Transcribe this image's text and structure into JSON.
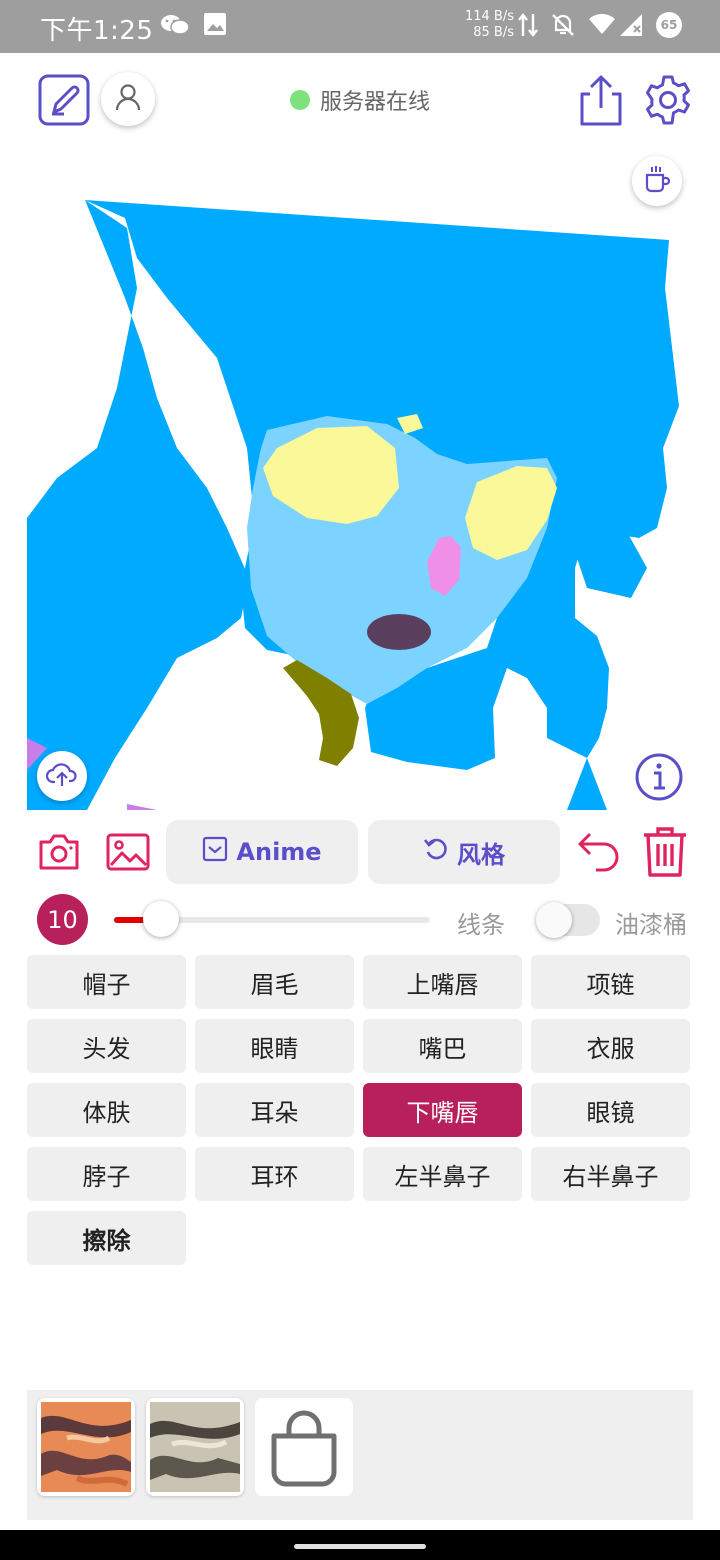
{
  "status_bar": {
    "time": "下午1:25",
    "speed_up": "114 B/s",
    "speed_down": "85 B/s",
    "battery": "65",
    "icons": [
      "wechat-icon",
      "image-icon",
      "data-arrows-icon",
      "mute-bell-icon",
      "wifi-icon",
      "signal-icon"
    ]
  },
  "header": {
    "server_status": "服务器在线",
    "server_status_color": "#7ee27c",
    "icons": [
      "edit-icon",
      "user-icon",
      "share-icon",
      "settings-icon"
    ]
  },
  "canvas": {
    "icons": [
      "coffee-icon",
      "cloud-upload-icon",
      "info-icon"
    ],
    "segment_colors": {
      "hair": "#00aaff",
      "skin": "#7dd3ff",
      "eyes": "#fbf89a",
      "ear": "#f08fe8",
      "mouth": "#5a3f5e",
      "neck": "#7f7f00"
    }
  },
  "tools": {
    "anime_label": "Anime",
    "style_label": "风格",
    "icons": [
      "camera-icon",
      "gallery-icon",
      "checkbox-icon",
      "refresh-icon",
      "undo-icon",
      "trash-icon"
    ]
  },
  "brush": {
    "size": "10",
    "slider_fraction": 0.15,
    "line_label": "线条",
    "bucket_label": "油漆桶",
    "bucket_enabled": false
  },
  "labels": [
    [
      "帽子",
      "眉毛",
      "上嘴唇",
      "项链"
    ],
    [
      "头发",
      "眼睛",
      "嘴巴",
      "衣服"
    ],
    [
      "体肤",
      "耳朵",
      "下嘴唇",
      "眼镜"
    ],
    [
      "脖子",
      "耳环",
      "左半鼻子",
      "右半鼻子"
    ],
    [
      "擦除"
    ]
  ],
  "selected_label": "下嘴唇",
  "accent_color": "#b8205c",
  "brand_color": "#5b4fc9",
  "tray": {
    "icons": [
      "style-thumbnail-orange",
      "style-thumbnail-gray",
      "shopping-bag-icon"
    ]
  }
}
